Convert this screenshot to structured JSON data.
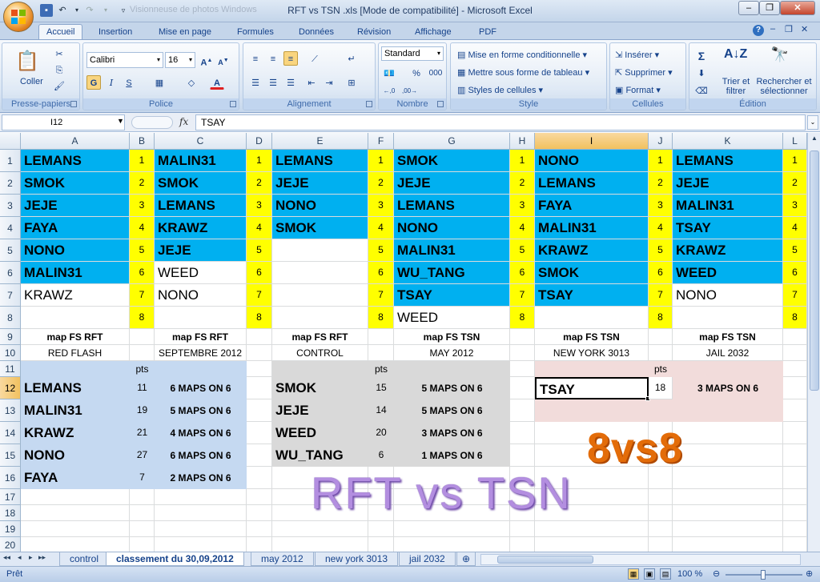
{
  "window": {
    "title": "RFT vs TSN .xls  [Mode de compatibilité] - Microsoft Excel",
    "ghost_text": "Visionneuse de photos Windows"
  },
  "ribbon": {
    "tabs": [
      "Accueil",
      "Insertion",
      "Mise en page",
      "Formules",
      "Données",
      "Révision",
      "Affichage",
      "PDF"
    ],
    "active_tab": "Accueil",
    "clipboard": {
      "paste": "Coller",
      "label": "Presse-papiers"
    },
    "font": {
      "name": "Calibri",
      "size": "16",
      "bold": "G",
      "italic": "I",
      "underline": "S",
      "label": "Police"
    },
    "alignment": {
      "label": "Alignement"
    },
    "number": {
      "format": "Standard",
      "percent": "%",
      "thousands": "000",
      "label": "Nombre"
    },
    "style": {
      "conditional": "Mise en forme conditionnelle",
      "table": "Mettre sous forme de tableau",
      "cell_styles": "Styles de cellules",
      "label": "Style"
    },
    "cells": {
      "insert": "Insérer",
      "delete": "Supprimer",
      "format": "Format",
      "label": "Cellules"
    },
    "editing": {
      "sort": "Trier et filtrer",
      "find": "Rechercher et sélectionner",
      "label": "Édition",
      "sum": "Σ"
    }
  },
  "formula_bar": {
    "name_box": "I12",
    "fx": "fx",
    "value": "TSAY"
  },
  "columns": [
    "A",
    "B",
    "C",
    "D",
    "E",
    "F",
    "G",
    "H",
    "I",
    "J",
    "K",
    "L"
  ],
  "selected_column": "I",
  "selected_row": "12",
  "rows": [
    "1",
    "2",
    "3",
    "4",
    "5",
    "6",
    "7",
    "8",
    "9",
    "10",
    "11",
    "12",
    "13",
    "14",
    "15",
    "16",
    "17",
    "18",
    "19",
    "20"
  ],
  "lists": {
    "A": [
      "LEMANS",
      "SMOK",
      "JEJE",
      "FAYA",
      "NONO",
      "MALIN31",
      "KRAWZ"
    ],
    "C": [
      "MALIN31",
      "SMOK",
      "LEMANS",
      "KRAWZ",
      "JEJE",
      "WEED",
      "NONO"
    ],
    "E": [
      "LEMANS",
      "JEJE",
      "NONO",
      "SMOK"
    ],
    "G": [
      "SMOK",
      "JEJE",
      "LEMANS",
      "NONO",
      "MALIN31",
      "WU_TANG",
      "TSAY",
      "WEED"
    ],
    "I": [
      "NONO",
      "LEMANS",
      "FAYA",
      "MALIN31",
      "KRAWZ",
      "SMOK",
      "TSAY"
    ],
    "K": [
      "LEMANS",
      "JEJE",
      "MALIN31",
      "TSAY",
      "KRAWZ",
      "WEED",
      "NONO"
    ]
  },
  "ranks": [
    "1",
    "2",
    "3",
    "4",
    "5",
    "6",
    "7",
    "8"
  ],
  "maps": [
    {
      "title": "map FS RFT",
      "name": "RED FLASH"
    },
    {
      "title": "map FS RFT",
      "name": "SEPTEMBRE 2012"
    },
    {
      "title": "map FS RFT",
      "name": "CONTROL"
    },
    {
      "title": "map FS TSN",
      "name": "MAY 2012"
    },
    {
      "title": "map FS TSN",
      "name": "NEW YORK 3013"
    },
    {
      "title": "map FS TSN",
      "name": "JAIL 2032"
    }
  ],
  "pts_label": "pts",
  "rft_scores": [
    {
      "player": "LEMANS",
      "pts": "11",
      "maps": "6 MAPS ON 6"
    },
    {
      "player": "MALIN31",
      "pts": "19",
      "maps": "5 MAPS ON 6"
    },
    {
      "player": "KRAWZ",
      "pts": "21",
      "maps": "4 MAPS ON 6"
    },
    {
      "player": "NONO",
      "pts": "27",
      "maps": "6 MAPS ON 6"
    },
    {
      "player": "FAYA",
      "pts": "7",
      "maps": "2 MAPS ON 6"
    }
  ],
  "tsn_scores": [
    {
      "player": "SMOK",
      "pts": "15",
      "maps": "5 MAPS ON 6"
    },
    {
      "player": "JEJE",
      "pts": "14",
      "maps": "5 MAPS ON 6"
    },
    {
      "player": "WEED",
      "pts": "20",
      "maps": "3 MAPS ON 6"
    },
    {
      "player": "WU_TANG",
      "pts": "6",
      "maps": "1 MAPS ON 6"
    }
  ],
  "tsay_score": {
    "player": "TSAY",
    "pts": "18",
    "maps": "3 MAPS ON 6"
  },
  "wordart": {
    "format": "8vs8",
    "title": "RFT vs TSN"
  },
  "sheets": [
    "control",
    "classement du 30,09,2012",
    "may 2012",
    "new york 3013",
    "jail 2032"
  ],
  "active_sheet": "classement du 30,09,2012",
  "status": {
    "ready": "Prêt",
    "zoom": "100 %"
  },
  "colors": {
    "blue": "#00b0f0",
    "yellow": "#ffff00",
    "lightblue": "#c5d9f1",
    "gray": "#d9d9d9",
    "pink": "#f2dcdb",
    "orange": "#e36c09",
    "purple": "#b38ee0"
  }
}
